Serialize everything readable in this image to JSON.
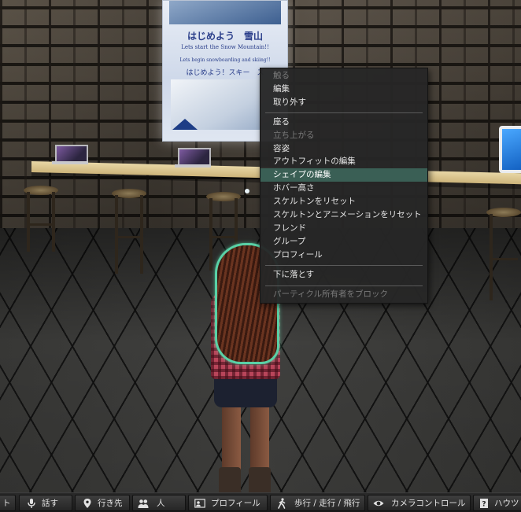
{
  "poster": {
    "title": "はじめよう　雪山",
    "subtitle": "Lets start the Snow Mountain!!",
    "subtitle2": "Lets begin snowboarding and skiing!!",
    "line": "はじめよう！スキー　ス"
  },
  "context_menu": {
    "items": [
      {
        "label": "触る",
        "state": "disabled"
      },
      {
        "label": "編集",
        "state": "normal"
      },
      {
        "label": "取り外す",
        "state": "normal"
      },
      {
        "separator": true
      },
      {
        "label": "座る",
        "state": "normal"
      },
      {
        "label": "立ち上がる",
        "state": "disabled"
      },
      {
        "label": "容姿",
        "state": "normal"
      },
      {
        "label": "アウトフィットの編集",
        "state": "normal"
      },
      {
        "label": "シェイプの編集",
        "state": "highlighted"
      },
      {
        "label": "ホバー高さ",
        "state": "normal"
      },
      {
        "label": "スケルトンをリセット",
        "state": "normal"
      },
      {
        "label": "スケルトンとアニメーションをリセット",
        "state": "normal"
      },
      {
        "label": "フレンド",
        "state": "normal"
      },
      {
        "label": "グループ",
        "state": "normal"
      },
      {
        "label": "プロフィール",
        "state": "normal"
      },
      {
        "separator": true
      },
      {
        "label": "下に落とす",
        "state": "normal"
      },
      {
        "separator": true
      },
      {
        "label": "パーティクル所有者をブロック",
        "state": "disabled"
      }
    ]
  },
  "toolbar": {
    "buttons": [
      {
        "label": "ト",
        "icon": "none"
      },
      {
        "label": "話す",
        "icon": "microphone-icon"
      },
      {
        "label": "行き先",
        "icon": "map-pin-icon"
      },
      {
        "label": "人",
        "icon": "people-icon"
      },
      {
        "label": "プロフィール",
        "icon": "profile-card-icon"
      },
      {
        "label": "歩行 / 走行 / 飛行",
        "icon": "walking-person-icon"
      },
      {
        "label": "カメラコントロール",
        "icon": "eye-icon"
      },
      {
        "label": "ハウツ",
        "icon": "help-book-icon"
      }
    ]
  },
  "colors": {
    "menu_bg": "#262626",
    "menu_highlight": "#3a5f55",
    "avatar_outline": "#59d1a6",
    "toolbar_bg": "#1a1a1a"
  }
}
